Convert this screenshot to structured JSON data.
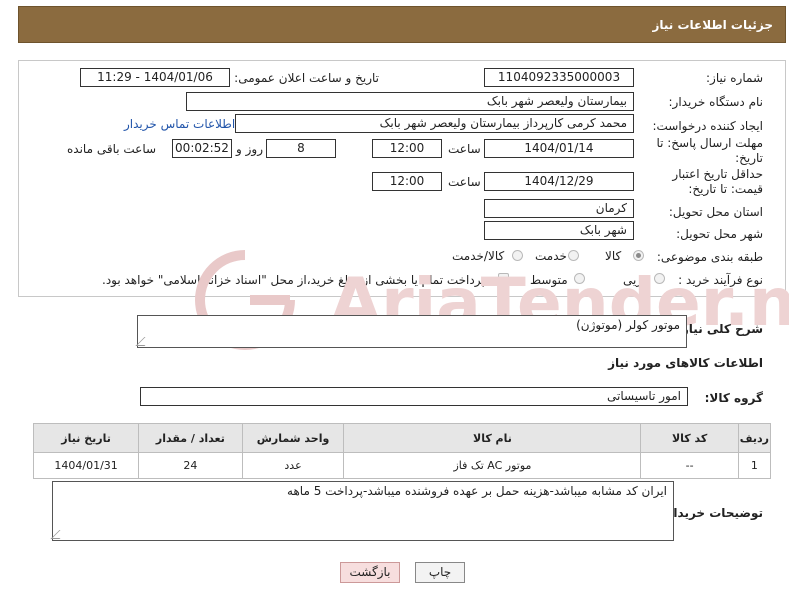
{
  "header": {
    "title": "جزئیات اطلاعات نیاز"
  },
  "form": {
    "need_number": {
      "label": "شماره نیاز:",
      "value": "1104092335000003"
    },
    "announce_datetime": {
      "label": "تاریخ و ساعت اعلان عمومی:",
      "value": "1404/01/06 - 11:29"
    },
    "buyer_org": {
      "label": "نام دستگاه خریدار:",
      "value": "بیمارستان ولیعصر شهر بابک"
    },
    "requester": {
      "label": "ایجاد کننده درخواست:",
      "value": "محمد  کرمی  کارپرداز  بیمارستان ولیعصر شهر بابک",
      "contact_link": "اطلاعات تماس خریدار"
    },
    "response_deadline": {
      "label": "مهلت ارسال پاسخ: تا تاریخ:",
      "date": "1404/01/14",
      "time_label": "ساعت",
      "time": "12:00",
      "days": "8",
      "days_label": "روز و",
      "remaining": "00:02:52",
      "remaining_label": "ساعت باقی مانده"
    },
    "price_validity": {
      "label": "حداقل تاریخ اعتبار قیمت: تا تاریخ:",
      "date": "1404/12/29",
      "time_label": "ساعت",
      "time": "12:00"
    },
    "province": {
      "label": "استان محل تحویل:",
      "value": "کرمان"
    },
    "city": {
      "label": "شهر محل تحویل:",
      "value": "شهر بابک"
    },
    "category": {
      "label": "طبقه بندی موضوعی:",
      "options": [
        "کالا",
        "خدمت",
        "کالا/خدمت"
      ],
      "selected": "کالا"
    },
    "purchase_type": {
      "label": "نوع فرآیند خرید :",
      "options": [
        "جزیی",
        "متوسط"
      ],
      "note": "پرداخت تمام یا بخشی از مبلغ خرید،از محل \"اسناد خزانه اسلامی\" خواهد بود."
    }
  },
  "summary": {
    "label": "شرح کلی نیاز:",
    "value": "موتور کولر (موتوژن)"
  },
  "goods_section": {
    "title": "اطلاعات کالاهای مورد نیاز"
  },
  "goods_group": {
    "label": "گروه کالا:",
    "value": "امور تاسیساتی"
  },
  "table": {
    "headers": [
      "ردیف",
      "کد کالا",
      "نام کالا",
      "واحد شمارش",
      "تعداد / مقدار",
      "تاریخ نیاز"
    ],
    "rows": [
      [
        "1",
        "--",
        "موتور AC تک فاز",
        "عدد",
        "24",
        "1404/01/31"
      ]
    ]
  },
  "buyer_notes": {
    "label": "توضیحات خریدار:",
    "value": "ایران کد مشابه میباشد-هزینه حمل بر عهده فروشنده میباشد-پرداخت 5 ماهه"
  },
  "buttons": {
    "print": "چاپ",
    "back": "بازگشت"
  },
  "watermark": {
    "text": "AriaTender.neT"
  },
  "colors": {
    "header_bg": "#8b6b3f",
    "link": "#2255aa",
    "watermark": "#e9c9c9"
  }
}
